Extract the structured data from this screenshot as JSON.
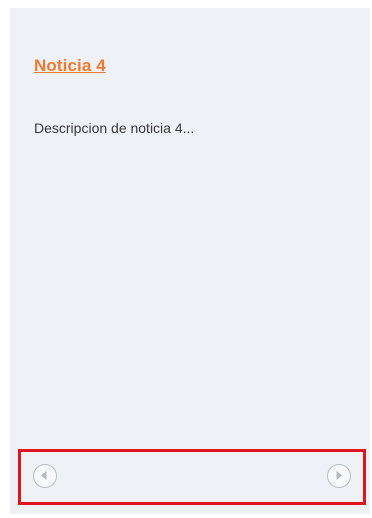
{
  "news": {
    "title": "Noticia 4",
    "description": "Descripcion de noticia 4..."
  },
  "navigation": {
    "prev_icon": "chevron-left-circle-icon",
    "next_icon": "chevron-right-circle-icon"
  },
  "colors": {
    "panel_background": "#eef1f5",
    "title_link": "#f07a2e",
    "description_text": "#3a3a3a",
    "highlight_border": "#e0141e",
    "nav_button": "#b9bec5"
  }
}
